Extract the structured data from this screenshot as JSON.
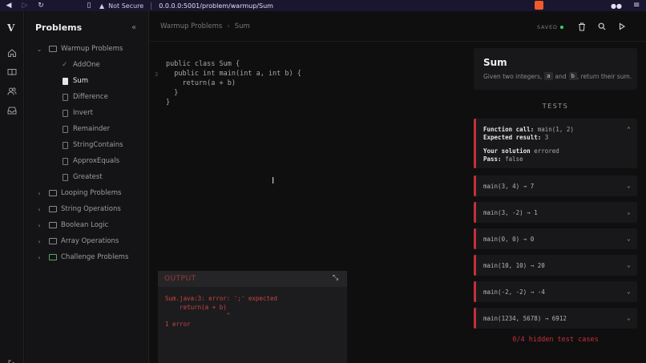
{
  "browser": {
    "security": "Not Secure",
    "url": "0.0.0.0:5001/problem/warmup/Sum"
  },
  "sidebar": {
    "title": "Problems",
    "tree": [
      {
        "label": "Warmup Problems",
        "type": "folder",
        "expanded": true
      },
      {
        "label": "AddOne",
        "type": "solved"
      },
      {
        "label": "Sum",
        "type": "file",
        "active": true
      },
      {
        "label": "Difference",
        "type": "file"
      },
      {
        "label": "Invert",
        "type": "file"
      },
      {
        "label": "Remainder",
        "type": "file"
      },
      {
        "label": "StringContains",
        "type": "file"
      },
      {
        "label": "ApproxEquals",
        "type": "file"
      },
      {
        "label": "Greatest",
        "type": "file"
      },
      {
        "label": "Looping Problems",
        "type": "folder"
      },
      {
        "label": "String Operations",
        "type": "folder"
      },
      {
        "label": "Boolean Logic",
        "type": "folder"
      },
      {
        "label": "Array Operations",
        "type": "folder"
      },
      {
        "label": "Challenge Problems",
        "type": "folder",
        "color": "#5aa36b"
      }
    ]
  },
  "editor": {
    "breadcrumb": [
      "Warmup Problems",
      "Sum"
    ],
    "saved_label": "SAVED",
    "code_lines": [
      {
        "num": "",
        "text": "public class Sum {"
      },
      {
        "num": "",
        "text": "  public int main(int a, int b) {"
      },
      {
        "num": "3",
        "text": "    return(a + b)"
      },
      {
        "num": "",
        "text": "  }"
      },
      {
        "num": "",
        "text": "}"
      }
    ]
  },
  "output": {
    "title": "OUTPUT",
    "text": "Sum.java:3: error: ';' expected\n    return(a + b)\n                 ^\n1 error"
  },
  "problem": {
    "title": "Sum",
    "desc_before": "Given two integers,",
    "param_a": "a",
    "desc_and": "and",
    "param_b": "b",
    "desc_after": ", return their sum."
  },
  "tests": {
    "title": "TESTS",
    "expanded": {
      "call_label": "Function call:",
      "call": "main(1, 2)",
      "expected_label": "Expected result:",
      "expected": "3",
      "solution_label": "Your solution",
      "solution": "errored",
      "pass_label": "Pass:",
      "pass": "false"
    },
    "cases": [
      "main(3, 4) → 7",
      "main(3, -2) → 1",
      "main(0, 0) → 0",
      "main(10, 10) → 20",
      "main(-2, -2) → -4",
      "main(1234, 5678) → 6912"
    ],
    "hidden": "0/4 hidden test cases"
  },
  "colors": {
    "fail": "#c6303a",
    "saved_dot": "#3fcf6e"
  }
}
